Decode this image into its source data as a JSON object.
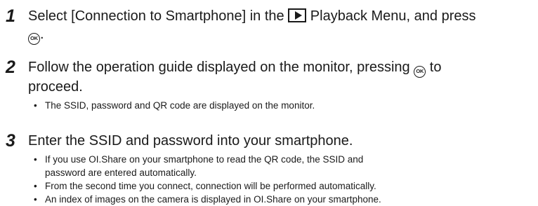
{
  "steps": [
    {
      "number": "1",
      "line1_a": "Select [Connection to Smartphone] in the",
      "line1_b": "Playback Menu, and press",
      "line2_a": ".",
      "ok_icon_label": "OK",
      "bullets": []
    },
    {
      "number": "2",
      "line1_a": "Follow the operation guide displayed on the monitor, pressing",
      "line1_b": "to",
      "line2_a": "proceed.",
      "ok_icon_label": "OK",
      "bullets": [
        "The SSID, password and QR code are displayed on the monitor."
      ]
    },
    {
      "number": "3",
      "text": "Enter the SSID and password into your smartphone.",
      "bullets": [
        "If you use OI.Share on your smartphone to read the QR code, the SSID and",
        "password are entered automatically.",
        "From the second time you connect, connection will be performed automatically.",
        "An index of images on the camera is displayed in OI.Share on your smartphone."
      ]
    }
  ],
  "bullet_symbol": "•",
  "icons": {
    "playback": "playback-icon",
    "ok": "ok-button-icon"
  }
}
